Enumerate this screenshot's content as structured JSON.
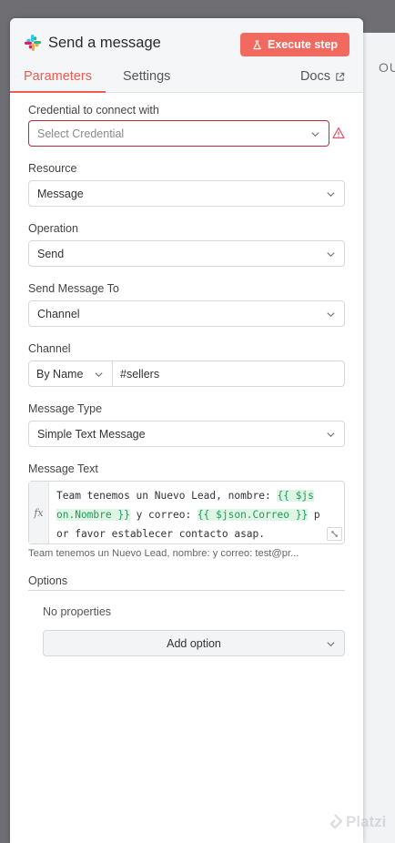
{
  "background": {
    "right_label": "OU"
  },
  "header": {
    "title": "Send a message",
    "icon": "slack-icon",
    "execute_label": "Execute step",
    "accent": "#f26a5f"
  },
  "tabs": {
    "parameters": "Parameters",
    "settings": "Settings",
    "docs": "Docs"
  },
  "fields": {
    "credential": {
      "label": "Credential to connect with",
      "placeholder": "Select Credential",
      "error_color": "#b5303d"
    },
    "resource": {
      "label": "Resource",
      "value": "Message"
    },
    "operation": {
      "label": "Operation",
      "value": "Send"
    },
    "send_to": {
      "label": "Send Message To",
      "value": "Channel"
    },
    "channel": {
      "label": "Channel",
      "mode": "By Name",
      "value": "#sellers"
    },
    "message_type": {
      "label": "Message Type",
      "value": "Simple Text Message"
    },
    "message_text": {
      "label": "Message Text",
      "fx": "fx",
      "line1_text": "Team tenemos un Nuevo Lead, nombre: ",
      "line1_expr": "{{ $js",
      "line2_expr": "on.Nombre }}",
      "line2_text": " y correo: ",
      "line2_expr2": "{{ $json.Correo }}",
      "line2_tail": " p",
      "line3_text": "or favor establecer contacto asap.",
      "preview": "Team tenemos un Nuevo Lead, nombre:   y correo: test@pr..."
    }
  },
  "options": {
    "label": "Options",
    "empty": "No properties",
    "add_label": "Add option"
  },
  "watermark": "Platzi"
}
